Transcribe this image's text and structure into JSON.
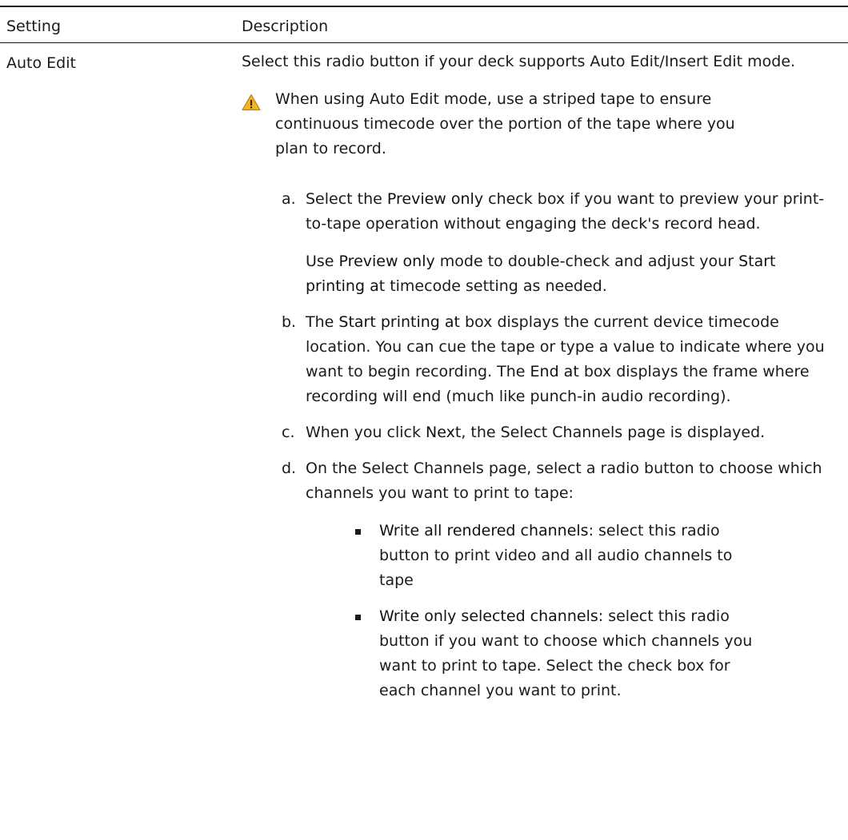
{
  "table": {
    "header_setting": "Setting",
    "header_description": "Description",
    "row_setting": "Auto Edit",
    "intro": "Select this radio button if your deck supports Auto Edit/Insert Edit mode.",
    "note": "When using Auto Edit mode, use a striped tape to ensure continuous timecode over the portion of the tape where you plan to record.",
    "steps": [
      {
        "letter": "a.",
        "t1": "Select the ",
        "b1": "Preview only",
        "t2": " check box if you want to preview your print-to-tape operation without engaging the deck's record head."
      },
      {
        "t1": "Use ",
        "b1": "Preview only",
        "t2": " mode to double-check and adjust your ",
        "b2": "Start printing at",
        "t3": " timecode setting as needed."
      },
      {
        "letter": "b.",
        "t1": "The ",
        "b1": "Start printing at",
        "t2": " box displays the current device timecode location. You can cue the tape or type a value to indicate where you want to begin recording. The ",
        "b2": "End at",
        "t3": " box displays the frame where recording will end (much like punch-in audio recording)."
      },
      {
        "letter": "c.",
        "t1": "When you click ",
        "b1": "Next",
        "t2": ", the Select Channels page is displayed."
      },
      {
        "letter": "d.",
        "t1": "On the Select Channels page, select a radio button to choose which channels you want to print to tape:"
      }
    ],
    "bullets": [
      {
        "b1": "Write all rendered channels",
        "t1": ": select this radio button to print video and all audio channels to tape"
      },
      {
        "b1": "Write only selected channels",
        "t1": ": select this radio button if you want to choose which channels you want to print to tape. Select the check box for each channel you want to print."
      }
    ]
  },
  "icons": {
    "note": "warning-triangle-icon"
  },
  "colors": {
    "warning_fill": "#f2b52a",
    "warning_stroke": "#b8860b",
    "rule": "#1a1a1a"
  }
}
